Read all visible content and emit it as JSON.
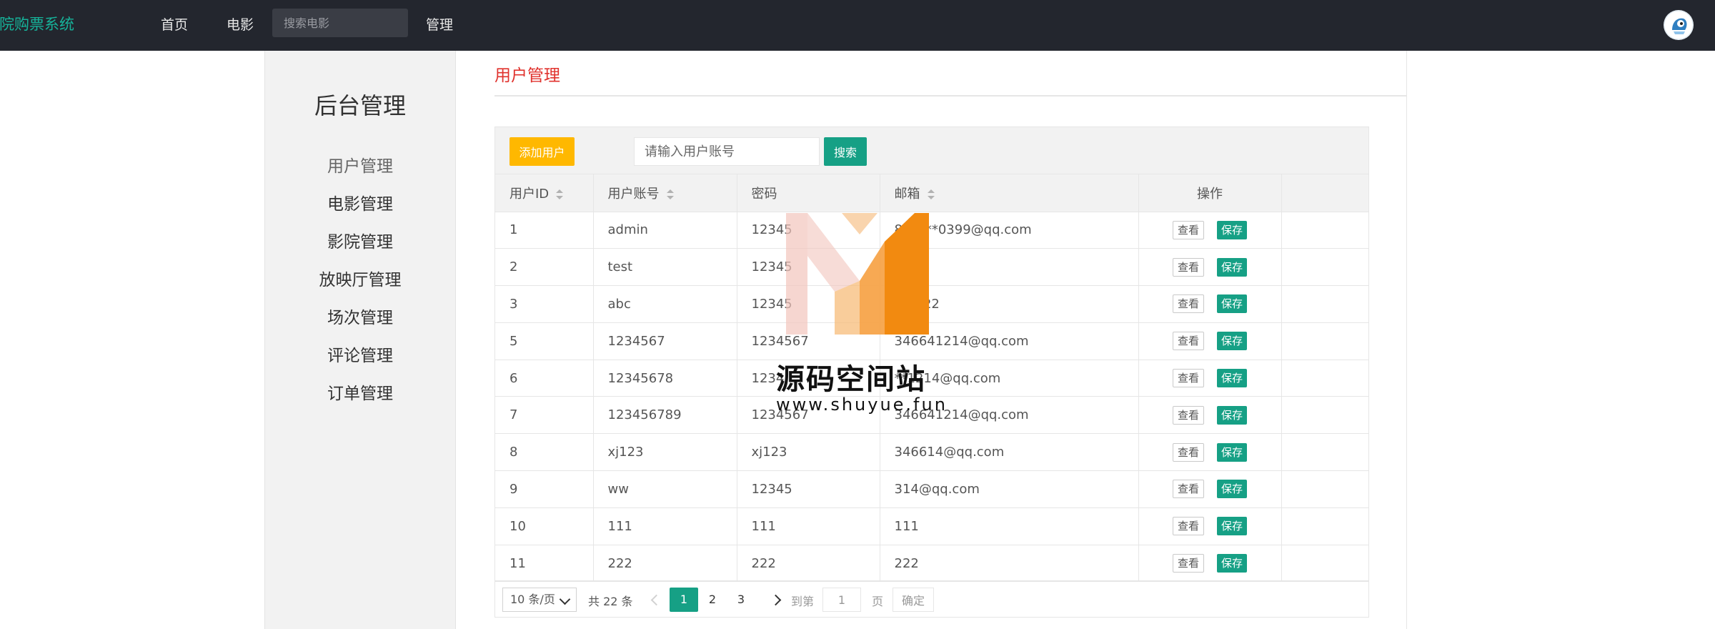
{
  "nav": {
    "brand": "影院购票系统",
    "home": "首页",
    "movie": "电影",
    "search_placeholder": "搜索电影",
    "manage": "管理"
  },
  "sidebar": {
    "title": "后台管理",
    "items": [
      {
        "label": "用户管理",
        "active": true
      },
      {
        "label": "电影管理"
      },
      {
        "label": "影院管理"
      },
      {
        "label": "放映厅管理"
      },
      {
        "label": "场次管理"
      },
      {
        "label": "评论管理"
      },
      {
        "label": "订单管理"
      }
    ]
  },
  "main": {
    "title": "用户管理",
    "add_button": "添加用户",
    "search_placeholder": "请输入用户账号",
    "search_button": "搜索"
  },
  "table": {
    "headers": [
      "用户ID",
      "用户账号",
      "密码",
      "邮箱",
      "操作"
    ],
    "view_label": "查看",
    "save_label": "保存",
    "rows": [
      [
        "1",
        "admin",
        "12345",
        "823***0399@qq.com"
      ],
      [
        "2",
        "test",
        "12345",
        "22"
      ],
      [
        "3",
        "abc",
        "12345",
        "ab**22"
      ],
      [
        "5",
        "1234567",
        "1234567",
        "346641214@qq.com"
      ],
      [
        "6",
        "12345678",
        "1234",
        "**1214@qq.com"
      ],
      [
        "7",
        "123456789",
        "1234567",
        "346641214@qq.com"
      ],
      [
        "8",
        "xj123",
        "xj123",
        "346614@qq.com"
      ],
      [
        "9",
        "ww",
        "12345",
        "314@qq.com"
      ],
      [
        "10",
        "111",
        "111",
        "111"
      ],
      [
        "11",
        "222",
        "222",
        "222"
      ]
    ]
  },
  "pager": {
    "page_size": "10 条/页",
    "total": "共 22 条",
    "pages": [
      "1",
      "2",
      "3"
    ],
    "current": "1",
    "goto_label": "到第",
    "goto_value": "1",
    "page_label": "页",
    "confirm": "确定"
  },
  "watermark": {
    "text": "源码空间站",
    "url": "www.shuyue.fun"
  },
  "colors": {
    "nav_bg": "#23262e",
    "brand": "#16b39a",
    "accent": "#16a085",
    "warn": "#ffb800",
    "title_red": "#e0322d"
  }
}
